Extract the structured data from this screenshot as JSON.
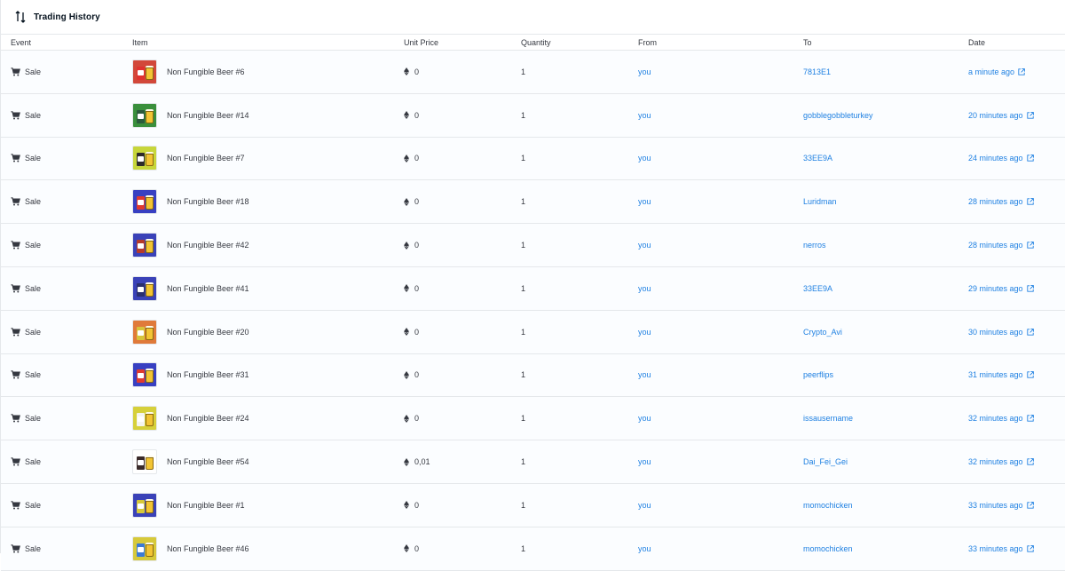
{
  "header": {
    "title": "Trading History",
    "icon": "swap-vertical-icon"
  },
  "columns": {
    "event": "Event",
    "item": "Item",
    "unit_price": "Unit Price",
    "quantity": "Quantity",
    "from": "From",
    "to": "To",
    "date": "Date"
  },
  "colors": {
    "link": "#2081e2",
    "border": "#e5e8eb",
    "text": "#353840",
    "row_bg": "#fbfdff"
  },
  "rows": [
    {
      "event": "Sale",
      "item": "Non Fungible Beer #6",
      "price": "0",
      "quantity": "1",
      "from": "you",
      "to": "7813E1",
      "date": "a minute ago",
      "thumb_bg": "#d2483a",
      "can_color": "#e0322f"
    },
    {
      "event": "Sale",
      "item": "Non Fungible Beer #14",
      "price": "0",
      "quantity": "1",
      "from": "you",
      "to": "gobblegobbleturkey",
      "date": "20 minutes ago",
      "thumb_bg": "#3a8f3c",
      "can_color": "#2b5a3c"
    },
    {
      "event": "Sale",
      "item": "Non Fungible Beer #7",
      "price": "0",
      "quantity": "1",
      "from": "you",
      "to": "33EE9A",
      "date": "24 minutes ago",
      "thumb_bg": "#c7d63a",
      "can_color": "#2d2a2a"
    },
    {
      "event": "Sale",
      "item": "Non Fungible Beer #18",
      "price": "0",
      "quantity": "1",
      "from": "you",
      "to": "Luridman",
      "date": "28 minutes ago",
      "thumb_bg": "#3840c2",
      "can_color": "#e03a2f"
    },
    {
      "event": "Sale",
      "item": "Non Fungible Beer #42",
      "price": "0",
      "quantity": "1",
      "from": "you",
      "to": "nerros",
      "date": "28 minutes ago",
      "thumb_bg": "#3a42b8",
      "can_color": "#b53a2a"
    },
    {
      "event": "Sale",
      "item": "Non Fungible Beer #41",
      "price": "0",
      "quantity": "1",
      "from": "you",
      "to": "33EE9A",
      "date": "29 minutes ago",
      "thumb_bg": "#3a42b8",
      "can_color": "#2a2f6e"
    },
    {
      "event": "Sale",
      "item": "Non Fungible Beer #20",
      "price": "0",
      "quantity": "1",
      "from": "you",
      "to": "Crypto_Avi",
      "date": "30 minutes ago",
      "thumb_bg": "#e07a3a",
      "can_color": "#d7c43a"
    },
    {
      "event": "Sale",
      "item": "Non Fungible Beer #31",
      "price": "0",
      "quantity": "1",
      "from": "you",
      "to": "peerflips",
      "date": "31 minutes ago",
      "thumb_bg": "#3840c2",
      "can_color": "#e03a2f"
    },
    {
      "event": "Sale",
      "item": "Non Fungible Beer #24",
      "price": "0",
      "quantity": "1",
      "from": "you",
      "to": "issausername",
      "date": "32 minutes ago",
      "thumb_bg": "#d6d03a",
      "can_color": "#f4f4f0"
    },
    {
      "event": "Sale",
      "item": "Non Fungible Beer #54",
      "price": "0,01",
      "quantity": "1",
      "from": "you",
      "to": "Dai_Fei_Gei",
      "date": "32 minutes ago",
      "thumb_bg": "#ffffff",
      "can_color": "#3a2a2a"
    },
    {
      "event": "Sale",
      "item": "Non Fungible Beer #1",
      "price": "0",
      "quantity": "1",
      "from": "you",
      "to": "momochicken",
      "date": "33 minutes ago",
      "thumb_bg": "#3a42b8",
      "can_color": "#d6c93a"
    },
    {
      "event": "Sale",
      "item": "Non Fungible Beer #46",
      "price": "0",
      "quantity": "1",
      "from": "you",
      "to": "momochicken",
      "date": "33 minutes ago",
      "thumb_bg": "#d6c93a",
      "can_color": "#3a7ad6"
    }
  ]
}
